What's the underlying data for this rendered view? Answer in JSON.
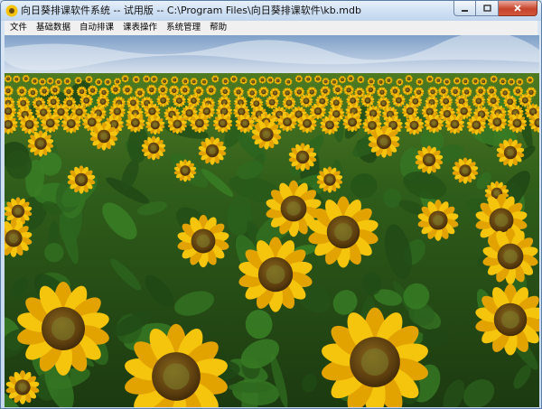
{
  "window": {
    "title": "向日葵排课软件系统 -- 试用版   -- C:\\Program Files\\向日葵排课软件\\kb.mdb"
  },
  "caption_buttons": {
    "minimize_icon": "minimize-icon",
    "maximize_icon": "maximize-icon",
    "close_icon": "close-icon"
  },
  "menu": {
    "items": [
      "文件",
      "基础数据",
      "自动排课",
      "课表操作",
      "系统管理",
      "帮助"
    ]
  },
  "content": {
    "image": "sunflower-field-background"
  },
  "colors": {
    "sky": "#9fb7d6",
    "petal": "#f5c40c",
    "petal_dark": "#e2a300",
    "center": "#6b4a12",
    "leaf": "#2f6a1f",
    "close_button": "#c7442c"
  }
}
